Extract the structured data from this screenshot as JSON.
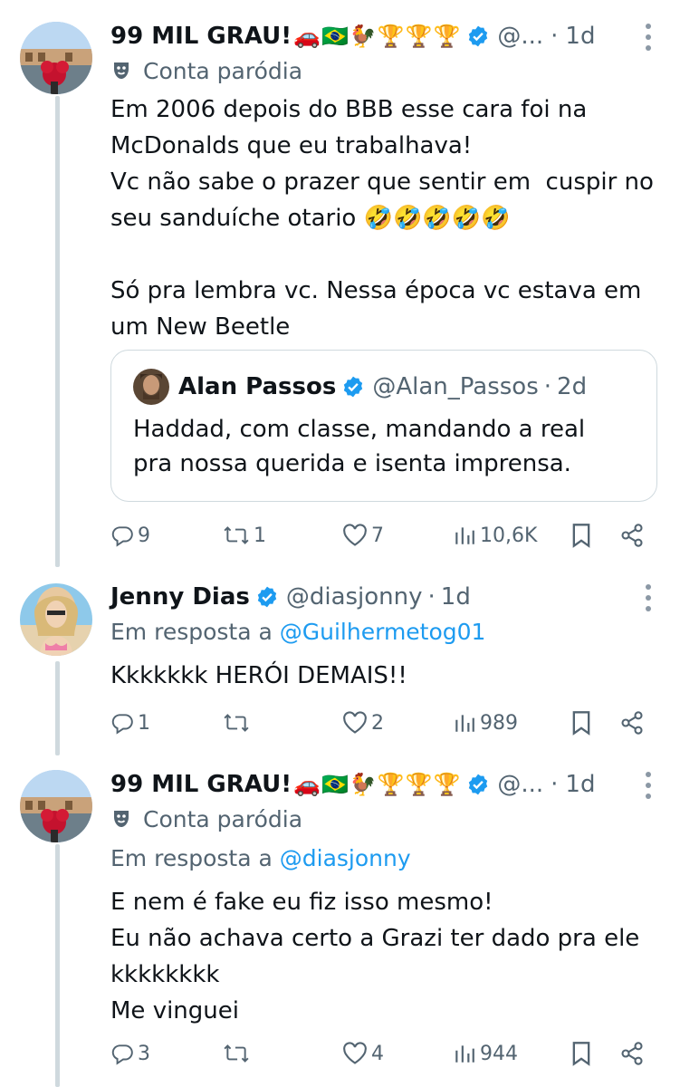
{
  "colors": {
    "accent": "#1d9bf0",
    "secondary_text": "#536471",
    "primary_text": "#0f1419",
    "border": "#cfd9de"
  },
  "tweets": [
    {
      "name": "99 MIL GRAU!",
      "name_emojis": "🚗🇧🇷🐓🏆🏆🏆",
      "handle": "@...",
      "dot": "·",
      "time": "1d",
      "verified": true,
      "parody_label": "Conta paródia",
      "body": "Em 2006 depois do BBB esse cara foi na\nMcDonalds que eu trabalhava!\nVc não sabe o prazer que sentir em  cuspir no\nseu sanduíche otario 🤣🤣🤣🤣🤣\n\nSó pra lembra vc. Nessa época vc estava em\num New Beetle",
      "quote": {
        "name": "Alan Passos",
        "handle": "@Alan_Passos",
        "dot": "·",
        "time": "2d",
        "text": "Haddad, com classe, mandando a real\npra nossa querida e isenta imprensa."
      },
      "actions": {
        "replies": "9",
        "reposts": "1",
        "likes": "7",
        "views": "10,6K"
      }
    },
    {
      "name": "Jenny Dias",
      "handle": "@diasjonny",
      "dot": "·",
      "time": "1d",
      "verified": true,
      "reply_prefix": "Em resposta a",
      "reply_mention": "@Guilhermetog01",
      "body": "Kkkkkkk HERÓI DEMAIS!!",
      "actions": {
        "replies": "1",
        "reposts": "",
        "likes": "2",
        "views": "989"
      }
    },
    {
      "name": "99 MIL GRAU!",
      "name_emojis": "🚗🇧🇷🐓🏆🏆🏆",
      "handle": "@...",
      "dot": "·",
      "time": "1d",
      "verified": true,
      "parody_label": "Conta paródia",
      "reply_prefix": "Em resposta a",
      "reply_mention": "@diasjonny",
      "body": "E nem é fake eu fiz isso mesmo!\nEu não achava certo a Grazi ter dado pra ele\nkkkkkkkk\nMe vinguei",
      "actions": {
        "replies": "3",
        "reposts": "",
        "likes": "4",
        "views": "944"
      }
    }
  ]
}
